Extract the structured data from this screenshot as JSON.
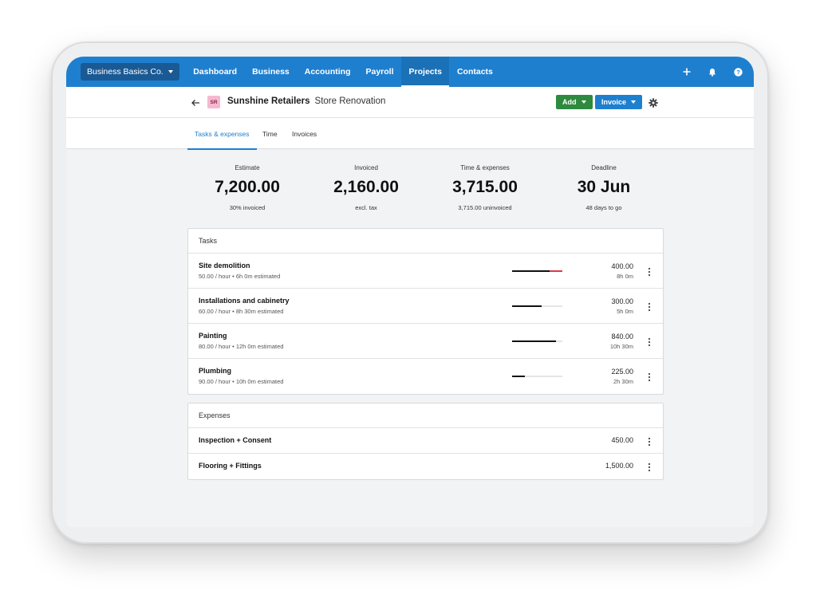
{
  "nav": {
    "org": "Business Basics Co.",
    "items": [
      {
        "label": "Dashboard",
        "active": false
      },
      {
        "label": "Business",
        "active": false
      },
      {
        "label": "Accounting",
        "active": false
      },
      {
        "label": "Payroll",
        "active": false
      },
      {
        "label": "Projects",
        "active": true
      },
      {
        "label": "Contacts",
        "active": false
      }
    ],
    "icons": [
      "plus-icon",
      "bell-icon",
      "help-icon"
    ]
  },
  "project": {
    "avatar": "SR",
    "client": "Sunshine Retailers",
    "name": "Store Renovation",
    "add_label": "Add",
    "invoice_label": "Invoice"
  },
  "tabs": [
    {
      "label": "Tasks & expenses",
      "active": true
    },
    {
      "label": "Time",
      "active": false
    },
    {
      "label": "Invoices",
      "active": false
    }
  ],
  "stats": [
    {
      "label": "Estimate",
      "value": "7,200.00",
      "sub": "30% invoiced"
    },
    {
      "label": "Invoiced",
      "value": "2,160.00",
      "sub": "excl. tax"
    },
    {
      "label": "Time & expenses",
      "value": "3,715.00",
      "sub": "3,715.00 uninvoiced"
    },
    {
      "label": "Deadline",
      "value": "30 Jun",
      "sub": "48 days to go"
    }
  ],
  "tasks": {
    "heading": "Tasks",
    "rows": [
      {
        "name": "Site demolition",
        "meta": "50.00 / hour • 6h 0m estimated",
        "amount": "400.00",
        "time": "8h 0m",
        "progress": 1.33
      },
      {
        "name": "Installations and cabinetry",
        "meta": "60.00 / hour • 8h 30m estimated",
        "amount": "300.00",
        "time": "5h 0m",
        "progress": 0.59
      },
      {
        "name": "Painting",
        "meta": "80.00 / hour • 12h 0m estimated",
        "amount": "840.00",
        "time": "10h 30m",
        "progress": 0.875
      },
      {
        "name": "Plumbing",
        "meta": "90.00 / hour • 10h 0m estimated",
        "amount": "225.00",
        "time": "2h 30m",
        "progress": 0.25
      }
    ]
  },
  "expenses": {
    "heading": "Expenses",
    "rows": [
      {
        "name": "Inspection + Consent",
        "amount": "450.00"
      },
      {
        "name": "Flooring + Fittings",
        "amount": "1,500.00"
      }
    ]
  },
  "colors": {
    "nav": "#1f7fcf",
    "add_button": "#2e8a3f",
    "invoice_button": "#1f7fcf",
    "overrun": "#d93a4a"
  }
}
